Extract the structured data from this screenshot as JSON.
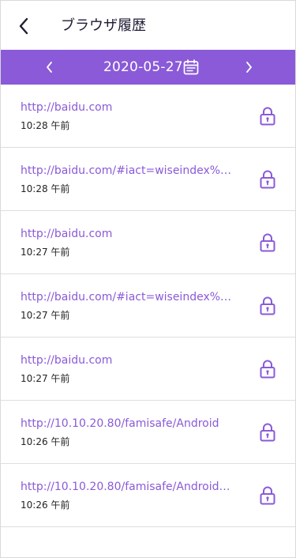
{
  "header": {
    "title": "ブラウザ履歴",
    "back_icon": "chevron-left-icon"
  },
  "date_bar": {
    "date": "2020-05-27",
    "prev_icon": "chevron-left-icon",
    "next_icon": "chevron-right-icon",
    "calendar_icon": "calendar-icon",
    "background": "#8a5ad8"
  },
  "history": [
    {
      "url": "http://baidu.com",
      "time": "10:28 午前",
      "icon": "lock-icon"
    },
    {
      "url": "http://baidu.com/#iact=wiseindex%…",
      "time": "10:28 午前",
      "icon": "lock-icon"
    },
    {
      "url": "http://baidu.com",
      "time": "10:27 午前",
      "icon": "lock-icon"
    },
    {
      "url": "http://baidu.com/#iact=wiseindex%…",
      "time": "10:27 午前",
      "icon": "lock-icon"
    },
    {
      "url": "http://baidu.com",
      "time": "10:27 午前",
      "icon": "lock-icon"
    },
    {
      "url": "http://10.10.20.80/famisafe/Android",
      "time": "10:26 午前",
      "icon": "lock-icon"
    },
    {
      "url": "http://10.10.20.80/famisafe/Android…",
      "time": "10:26 午前",
      "icon": "lock-icon"
    }
  ],
  "colors": {
    "accent": "#8a5ad8",
    "title_text": "#1d1d35",
    "divider": "#dedede"
  }
}
